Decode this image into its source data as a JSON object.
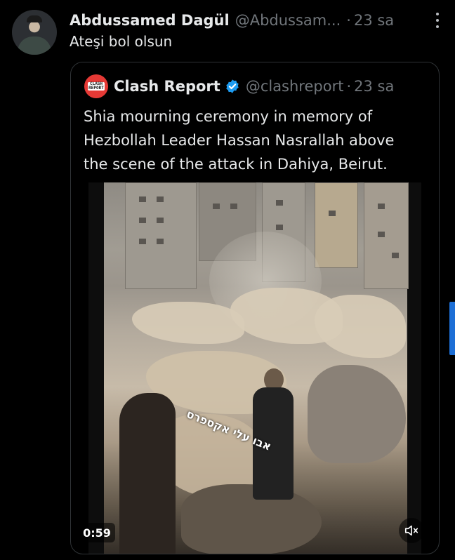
{
  "tweet": {
    "author_name": "Abdussamed Dagül",
    "handle": "@Abdussam...",
    "separator": "·",
    "time": "23 sa",
    "text": "Ateşi bol olsun",
    "avatar_icon": "user-avatar"
  },
  "quoted_tweet": {
    "author_name": "Clash Report",
    "handle": "@clashreport",
    "separator": "·",
    "time": "23 sa",
    "verified": true,
    "logo_text": "CLASH REPORT",
    "text_lines": [
      "Shia mourning ceremony in memory of",
      "Hezbollah Leader Hassan Nasrallah above",
      "the scene of the attack in Dahiya, Beirut."
    ],
    "video": {
      "duration": "0:59",
      "overlay_text": "אבו עלי אקספרס",
      "mute_icon": "volume-muted-icon"
    }
  },
  "colors": {
    "background": "#000000",
    "primary_text": "#e7e9ea",
    "secondary_text": "#71767b",
    "border": "#2f3336",
    "verified_blue": "#1d9bf0",
    "clash_red": "#e53935",
    "scroll_accent": "#1d6fd6"
  }
}
